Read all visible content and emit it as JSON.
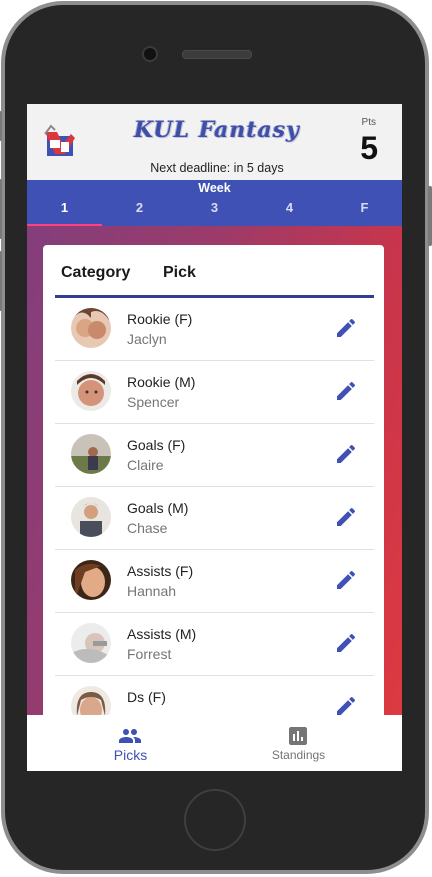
{
  "header": {
    "brand": "KUL Fantasy",
    "deadline": "Next deadline: in 5 days",
    "points_label": "Pts",
    "points_value": "5"
  },
  "week": {
    "title": "Week",
    "tabs": [
      {
        "label": "1",
        "active": true
      },
      {
        "label": "2",
        "active": false
      },
      {
        "label": "3",
        "active": false
      },
      {
        "label": "4",
        "active": false
      },
      {
        "label": "F",
        "active": false
      }
    ]
  },
  "card": {
    "columns": [
      "Category",
      "Pick"
    ],
    "rows": [
      {
        "category": "Rookie (F)",
        "pick": "Jaclyn"
      },
      {
        "category": "Rookie (M)",
        "pick": "Spencer"
      },
      {
        "category": "Goals (F)",
        "pick": "Claire"
      },
      {
        "category": "Goals (M)",
        "pick": "Chase"
      },
      {
        "category": "Assists (F)",
        "pick": "Hannah"
      },
      {
        "category": "Assists (M)",
        "pick": "Forrest"
      },
      {
        "category": "Ds (F)",
        "pick": ""
      }
    ],
    "edit_icon": "pencil-icon"
  },
  "bottom_nav": {
    "items": [
      {
        "label": "Picks",
        "icon": "people-icon",
        "active": true
      },
      {
        "label": "Standings",
        "icon": "bar-chart-icon",
        "active": false
      }
    ]
  },
  "colors": {
    "primary": "#3f51b5",
    "accent": "#ff4081",
    "gradient_start": "#7f3f7f",
    "gradient_end": "#e03a3f"
  }
}
